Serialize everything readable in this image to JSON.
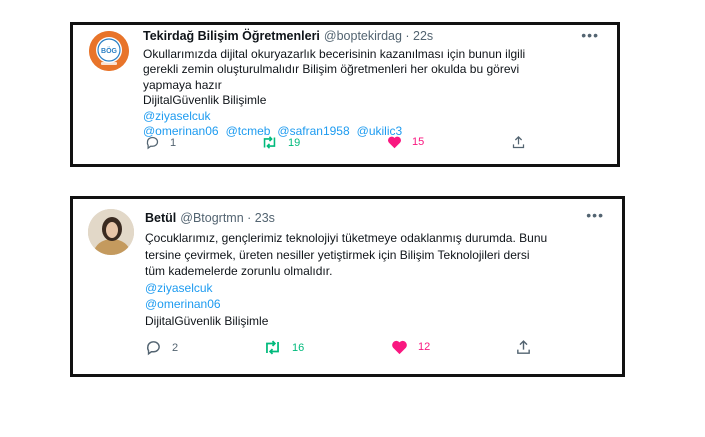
{
  "tweets": [
    {
      "name": "Tekirdağ Bilişim Öğretmenleri",
      "handle": "@boptekirdag · 22s",
      "text_lines": [
        "Okullarımızda dijital okuryazarlık becerisinin  kazanılması için bunun ilgili",
        "gerekli zemin oluşturulmalıdır  Bilişim öğretmenleri her okulda bu görevi",
        "yapmaya hazır",
        "DijitalGüvenlik Bilişimle"
      ],
      "mention_lines": [
        [
          "@ziyaselcuk"
        ],
        [
          "@omerinan06",
          "@tcmeb",
          "@safran1958",
          "@ukilic3"
        ]
      ],
      "replies": "1",
      "retweets": "19",
      "likes": "15",
      "avatar_label": "BÖG"
    },
    {
      "name": "Betül",
      "handle": "@Btogrtmn · 23s",
      "text_lines": [
        "Çocuklarımız, gençlerimiz teknolojiyi tüketmeye odaklanmış durumda. Bunu",
        "tersine çevirmek, üreten nesiller yetiştirmek için Bilişim Teknolojileri dersi",
        "tüm kademelerde zorunlu olmalıdır."
      ],
      "mention_lines": [
        [
          "@ziyaselcuk"
        ],
        [
          "@omerinan06"
        ]
      ],
      "footer_line": "DijitalGüvenlik Bilişimle",
      "replies": "2",
      "retweets": "16",
      "likes": "12"
    }
  ],
  "colors": {
    "mention": "#1d9bf0",
    "retweet": "#00ba7c",
    "like": "#f91880",
    "muted": "#536471"
  }
}
